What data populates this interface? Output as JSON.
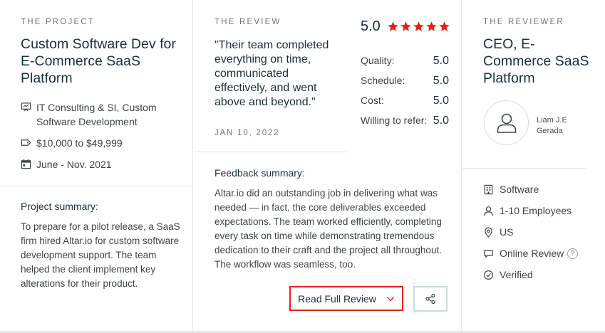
{
  "project": {
    "eyebrow": "THE PROJECT",
    "title": "Custom Software Dev for E-Commerce SaaS Platform",
    "services": "IT Consulting & SI, Custom Software Development",
    "budget": "$10,000 to $49,999",
    "dates": "June - Nov. 2021",
    "summary_label": "Project summary:",
    "summary_text": "To prepare for a pilot release, a SaaS firm hired Altar.io for custom software development support. The team helped the client implement key alterations for their product."
  },
  "review": {
    "eyebrow": "THE REVIEW",
    "quote": "\"Their team completed everything on time, communicated effectively, and went above and beyond.\"",
    "date": "JAN 10, 2022",
    "overall_score": "5.0",
    "stars": 5,
    "star_color": "#e62415",
    "ratings": [
      {
        "label": "Quality:",
        "value": "5.0"
      },
      {
        "label": "Schedule:",
        "value": "5.0"
      },
      {
        "label": "Cost:",
        "value": "5.0"
      },
      {
        "label": "Willing to refer:",
        "value": "5.0"
      }
    ],
    "feedback_label": "Feedback summary:",
    "feedback_text": "Altar.io did an outstanding job in delivering what was needed — in fact, the core deliverables exceeded expectations. The team worked efficiently, completing every task on time while demonstrating tremendous dedication to their craft and the project all throughout. The workflow was seamless, too.",
    "read_button": "Read Full Review",
    "share_icon": "share-icon"
  },
  "reviewer": {
    "eyebrow": "THE REVIEWER",
    "title": "CEO, E-Commerce SaaS Platform",
    "name": "Liam J.E Gerada",
    "industry": "Software",
    "employees": "1-10 Employees",
    "location": "US",
    "review_type": "Online Review",
    "help_glyph": "?",
    "verified": "Verified"
  },
  "colors": {
    "accent": "#e62415",
    "heading": "#17313b",
    "border": "#e3e6e9"
  }
}
